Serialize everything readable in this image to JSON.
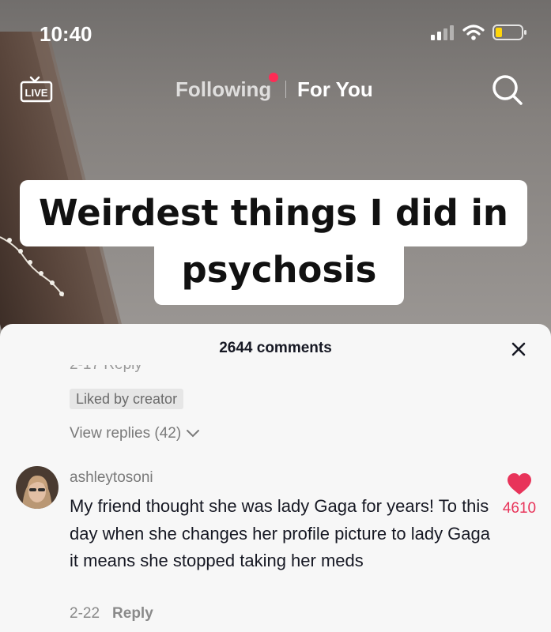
{
  "status_bar": {
    "time": "10:40"
  },
  "nav": {
    "live_label": "LIVE",
    "tabs": [
      {
        "label": "Following",
        "has_notification": true
      },
      {
        "label": "For You",
        "active": true
      }
    ]
  },
  "video": {
    "caption_line1": "Weirdest things I did in",
    "caption_line2": "psychosis"
  },
  "comments": {
    "count_label": "2644 comments",
    "previous_comment": {
      "meta_cut": "2-17   Reply",
      "badge": "Liked by creator",
      "view_replies": "View replies (42)"
    },
    "items": [
      {
        "username": "ashleytosoni",
        "text": "My friend thought she was lady Gaga for years! To this day when she changes her profile picture to lady Gaga it means she stopped taking her meds",
        "date": "2-22",
        "reply_label": "Reply",
        "likes": "4610"
      }
    ]
  },
  "colors": {
    "accent": "#fe2c55",
    "like": "#e8345a"
  }
}
